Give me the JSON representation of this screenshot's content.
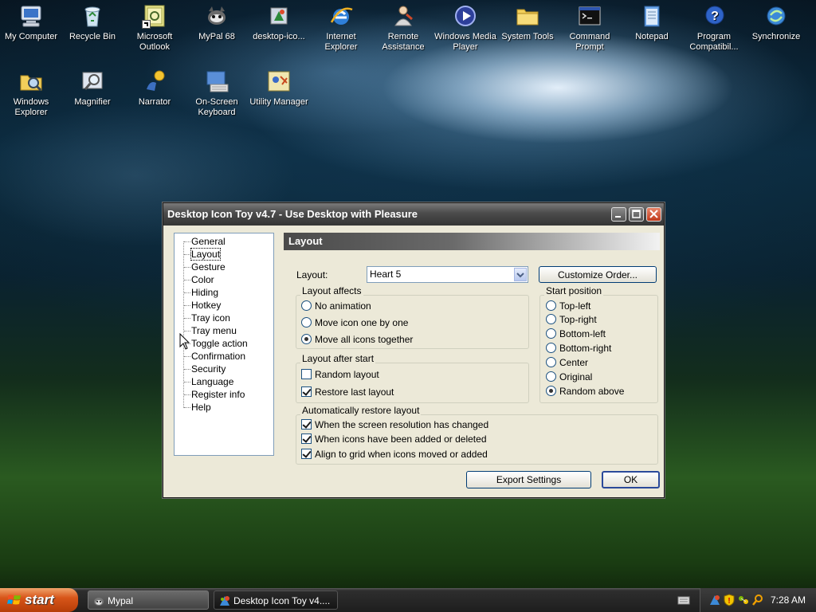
{
  "desktop": {
    "icons": [
      {
        "label": "My Computer",
        "icon": "computer-icon"
      },
      {
        "label": "Recycle Bin",
        "icon": "recycle-bin-icon"
      },
      {
        "label": "Microsoft Outlook",
        "icon": "outlook-icon"
      },
      {
        "label": "MyPal 68",
        "icon": "mypal-icon"
      },
      {
        "label": "desktop-ico...",
        "icon": "desktop-icon-toy-icon"
      },
      {
        "label": "Internet Explorer",
        "icon": "internet-explorer-icon"
      },
      {
        "label": "Remote Assistance",
        "icon": "remote-assistance-icon"
      },
      {
        "label": "Windows Media Player",
        "icon": "media-player-icon"
      },
      {
        "label": "System Tools",
        "icon": "folder-icon"
      },
      {
        "label": "Command Prompt",
        "icon": "command-prompt-icon"
      },
      {
        "label": "Notepad",
        "icon": "notepad-icon"
      },
      {
        "label": "Program Compatibil...",
        "icon": "help-icon"
      },
      {
        "label": "Synchronize",
        "icon": "synchronize-icon"
      },
      {
        "label": "Windows Explorer",
        "icon": "explorer-icon"
      },
      {
        "label": "Magnifier",
        "icon": "magnifier-icon"
      },
      {
        "label": "Narrator",
        "icon": "narrator-icon"
      },
      {
        "label": "On-Screen Keyboard",
        "icon": "keyboard-icon"
      },
      {
        "label": "Utility Manager",
        "icon": "utility-manager-icon"
      }
    ]
  },
  "window": {
    "title": "Desktop Icon Toy v4.7 - Use Desktop with Pleasure",
    "tree": [
      "General",
      "Layout",
      "Gesture",
      "Color",
      "Hiding",
      "Hotkey",
      "Tray icon",
      "Tray menu",
      "Toggle action",
      "Confirmation",
      "Security",
      "Language",
      "Register info",
      "Help"
    ],
    "selected_tree_item": "Layout",
    "panel_title": "Layout",
    "layout_label": "Layout:",
    "layout_value": "Heart 5",
    "customize_button": "Customize Order...",
    "layout_affects": {
      "title": "Layout affects",
      "options": [
        "No animation",
        "Move icon one by one",
        "Move all icons together"
      ],
      "selected": "Move all icons together"
    },
    "start_position": {
      "title": "Start position",
      "options": [
        "Top-left",
        "Top-right",
        "Bottom-left",
        "Bottom-right",
        "Center",
        "Original",
        "Random above"
      ],
      "selected": "Random above"
    },
    "layout_after_start": {
      "title": "Layout after start",
      "options": [
        {
          "label": "Random layout",
          "checked": false
        },
        {
          "label": "Restore last layout",
          "checked": true
        }
      ]
    },
    "auto_restore": {
      "title": "Automatically restore layout",
      "options": [
        {
          "label": "When the screen resolution has changed",
          "checked": true
        },
        {
          "label": "When icons have been added or deleted",
          "checked": true
        },
        {
          "label": "Align to grid when icons moved or added",
          "checked": true
        }
      ]
    },
    "export_button": "Export Settings",
    "ok_button": "OK"
  },
  "taskbar": {
    "start_label": "start",
    "tasks": [
      {
        "label": "Mypal"
      },
      {
        "label": "Desktop Icon Toy v4...."
      }
    ],
    "clock": "7:28 AM"
  }
}
